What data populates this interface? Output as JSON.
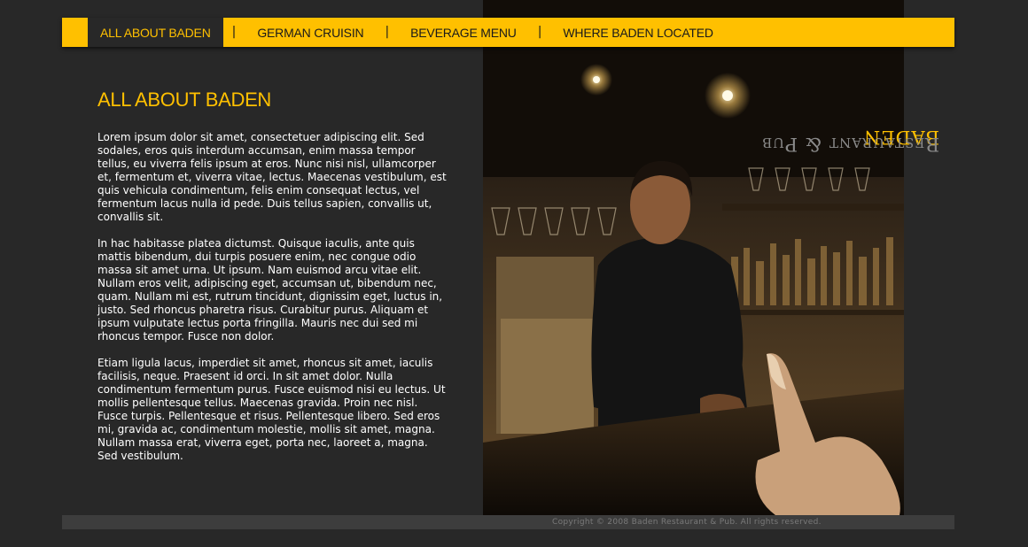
{
  "nav": {
    "items": [
      {
        "label": "ALL ABOUT BADEN",
        "active": true
      },
      {
        "label": "GERMAN CRUISIN",
        "active": false
      },
      {
        "label": "BEVERAGE MENU",
        "active": false
      },
      {
        "label": "WHERE BADEN LOCATED",
        "active": false
      }
    ],
    "separator": "|"
  },
  "main": {
    "title": "ALL ABOUT BADEN",
    "paragraphs": [
      "Lorem ipsum dolor sit amet, consectetuer adipiscing elit. Sed sodales, eros quis interdum accumsan, enim massa tempor tellus, eu viverra felis ipsum at eros. Nunc nisi nisl, ullamcorper et, fermentum et, viverra vitae, lectus. Maecenas vestibulum, est quis vehicula condimentum, felis enim consequat lectus, vel fermentum lacus nulla id pede. Duis tellus sapien, convallis ut, convallis sit.",
      "In hac habitasse platea dictumst. Quisque iaculis, ante quis mattis bibendum, dui turpis posuere enim, nec congue odio massa sit amet urna. Ut ipsum. Nam euismod arcu vitae elit. Nullam eros velit, adipiscing eget, accumsan ut, bibendum nec, quam. Nullam mi est, rutrum tincidunt, dignissim eget, luctus in, justo. Sed rhoncus pharetra risus. Curabitur purus. Aliquam et ipsum vulputate lectus porta fringilla. Mauris nec dui sed mi rhoncus tempor. Fusce non dolor.",
      "Etiam ligula lacus, imperdiet sit amet, rhoncus sit amet, iaculis facilisis, neque. Praesent id orci. In sit amet dolor. Nulla condimentum fermentum purus. Fusce euismod nisi eu lectus. Ut mollis pellentesque tellus. Maecenas gravida. Proin nec nisl. Fusce turpis. Pellentesque et risus. Pellentesque libero. Sed eros mi, gravida ac, condimentum molestie, mollis sit amet, magna. Nullam massa erat, viverra eget, porta nec, laoreet a, magna. Sed vestibulum."
    ]
  },
  "brand": {
    "name": "BADEN",
    "tagline": "Restaurant & Pub"
  },
  "footer": {
    "copyright": "Copyright © 2008 Baden Restaurant & Pub. All rights reserved."
  },
  "colors": {
    "accent": "#ffc000",
    "background": "#282828"
  }
}
